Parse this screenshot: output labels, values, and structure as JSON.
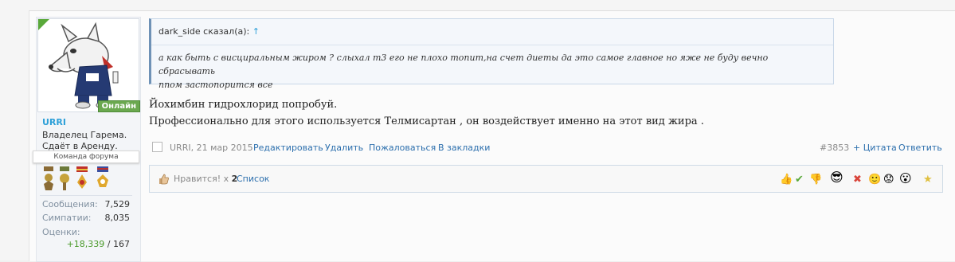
{
  "user": {
    "online_label": "Онлайн",
    "name": "URRI",
    "title_line1": "Владелец Гарема.",
    "title_line2": "Сдаёт в Аренду.",
    "team": "Команда форума",
    "stats": [
      {
        "label": "Сообщения:",
        "value": "7,529"
      },
      {
        "label": "Симпатии:",
        "value": "8,035"
      },
      {
        "label": "Оценки:",
        "pos": "+18,339",
        "sep": " / ",
        "neg": "167"
      }
    ]
  },
  "quote": {
    "author": "dark_side сказал(а):",
    "arrow": "↑",
    "line1": "а как быть с висциральным жиром ? слыхал т3 его не плохо топит,на счет диеты да это самое главное но яже не буду вечно сбрасывать",
    "line2": "ппом застопорится все"
  },
  "message": {
    "line1": "Йохимбин гидрохлорид попробуй.",
    "line2": "Профессионально для этого используется Телмисартан , он воздействует именно на этот вид жира ."
  },
  "meta": {
    "author_date": "URRI, 21 мар 2015",
    "edit": "Редактировать",
    "delete": "Удалить",
    "report": "Пожаловаться",
    "bookmark": "В закладки",
    "post_number": "#3853",
    "quote": "+ Цитата",
    "reply": "Ответить"
  },
  "likes": {
    "label": "Нравится! x",
    "count": "2",
    "list": "Список"
  },
  "ratings": [
    "thumbs-up-icon",
    "check-icon",
    "thumbs-down-icon",
    "cool-face-icon",
    "cross-icon",
    "smile-icon",
    "sad-face-icon",
    "surprised-face-icon",
    "star-icon"
  ],
  "colors": {
    "accent": "#2c6fad",
    "online": "#6aa84f",
    "username": "#2ea0d8"
  }
}
